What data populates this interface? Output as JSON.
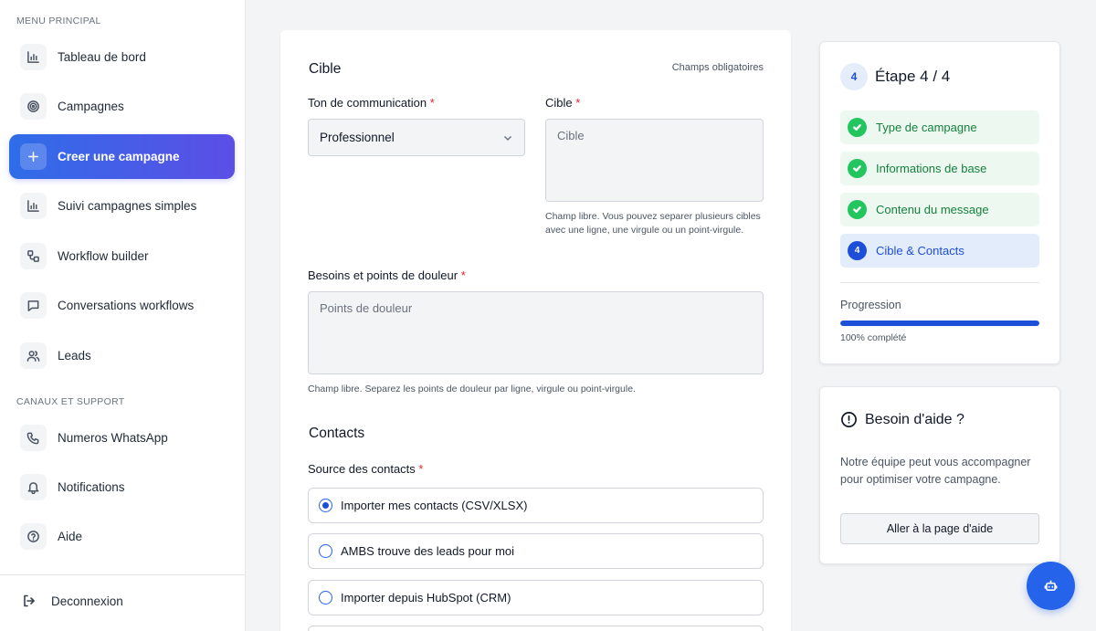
{
  "sidebar": {
    "section_main": "MENU PRINCIPAL",
    "section_support": "CANAUX ET SUPPORT",
    "items": [
      {
        "label": "Tableau de bord",
        "icon": "bar-chart-icon"
      },
      {
        "label": "Campagnes",
        "icon": "target-icon"
      },
      {
        "label": "Creer une campagne",
        "icon": "plus-icon"
      },
      {
        "label": "Suivi campagnes simples",
        "icon": "bar-chart-icon"
      },
      {
        "label": "Workflow builder",
        "icon": "workflow-icon"
      },
      {
        "label": "Conversations workflows",
        "icon": "message-icon"
      },
      {
        "label": "Leads",
        "icon": "users-icon"
      }
    ],
    "support_items": [
      {
        "label": "Numeros WhatsApp",
        "icon": "phone-icon"
      },
      {
        "label": "Notifications",
        "icon": "bell-icon"
      },
      {
        "label": "Aide",
        "icon": "help-circle-icon"
      }
    ],
    "logout_label": "Deconnexion"
  },
  "form": {
    "section_target": "Cible",
    "required_note": "Champs obligatoires",
    "tone_label": "Ton de communication",
    "tone_value": "Professionnel",
    "target_label": "Cible",
    "target_placeholder": "Cible",
    "target_help": "Champ libre. Vous pouvez separer plusieurs cibles avec une ligne, une virgule ou un point-virgule.",
    "pain_label": "Besoins et points de douleur",
    "pain_placeholder": "Points de douleur",
    "pain_help": "Champ libre. Separez les points de douleur par ligne, virgule ou point-virgule.",
    "required_star": "*",
    "section_contacts": "Contacts",
    "source_label": "Source des contacts",
    "sources": [
      {
        "label": "Importer mes contacts (CSV/XLSX)",
        "checked": true
      },
      {
        "label": "AMBS trouve des leads pour moi",
        "checked": false
      },
      {
        "label": "Importer depuis HubSpot (CRM)",
        "checked": false
      }
    ]
  },
  "steps": {
    "badge": "4",
    "title": "Étape 4 / 4",
    "items": [
      {
        "label": "Type de campagne",
        "done": true
      },
      {
        "label": "Informations de base",
        "done": true
      },
      {
        "label": "Contenu du message",
        "done": true
      },
      {
        "label": "Cible & Contacts",
        "done": false,
        "number": "4"
      }
    ],
    "progress_label": "Progression",
    "progress_value": 1.0,
    "progress_text": "100% complété"
  },
  "help": {
    "title": "Besoin d'aide ?",
    "description": "Notre équipe peut vous accompagner pour optimiser votre campagne.",
    "button": "Aller à la page d'aide"
  },
  "colors": {
    "accent": "#1d4ed8",
    "gradient_start": "#2f6de8",
    "gradient_end": "#5c4ee6",
    "success": "#22c55e"
  }
}
